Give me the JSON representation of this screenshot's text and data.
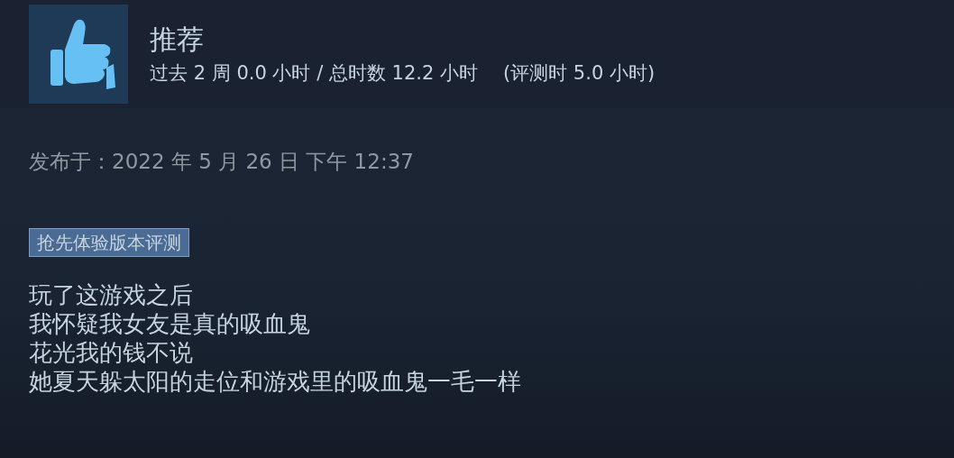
{
  "header": {
    "recommended": true,
    "verdict": "推荐",
    "hours": "过去 2 周 0.0 小时 / 总时数 12.2 小时",
    "hours_at_review": "(评测时 5.0 小时)"
  },
  "posted": "发布于：2022 年 5 月 26 日 下午 12:37",
  "tag": "抢先体验版本评测",
  "review_lines": [
    "玩了这游戏之后",
    "我怀疑我女友是真的吸血鬼",
    "花光我的钱不说",
    "她夏天躲太阳的走位和游戏里的吸血鬼一毛一样"
  ]
}
